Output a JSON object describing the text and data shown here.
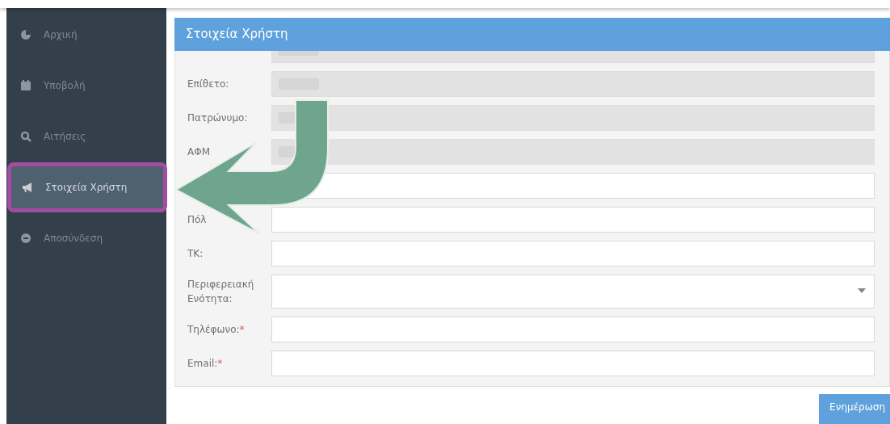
{
  "sidebar": {
    "items": [
      {
        "label": "Αρχική",
        "selected": false
      },
      {
        "label": "Υποβολή",
        "selected": false
      },
      {
        "label": "Αιτήσεις",
        "selected": false
      },
      {
        "label": "Στοιχεία Χρήστη",
        "selected": true,
        "highlighted": true
      },
      {
        "label": "Αποσύνδεση",
        "selected": false
      }
    ]
  },
  "panel": {
    "title": "Στοιχεία Χρήστη",
    "fields": [
      {
        "kind": "text",
        "disabled": true
      },
      {
        "kind": "text",
        "label": "Επίθετο:",
        "disabled": true
      },
      {
        "kind": "text",
        "label": "Πατρώνυμο:",
        "disabled": true
      },
      {
        "kind": "text",
        "label": "ΑΦΜ",
        "disabled": true
      },
      {
        "kind": "text",
        "disabled": false
      },
      {
        "kind": "text",
        "label": "Πόλ",
        "disabled": false
      },
      {
        "kind": "text",
        "label": "ΤΚ:",
        "disabled": false
      },
      {
        "kind": "select",
        "label": "Περιφερειακή Ενότητα:",
        "disabled": false
      },
      {
        "kind": "text",
        "label": "Τηλέφωνο:",
        "required_mark": "*",
        "disabled": false
      },
      {
        "kind": "text",
        "label": "Email:",
        "required_mark": "*",
        "disabled": false
      }
    ],
    "button": "Ενημέρωση"
  }
}
